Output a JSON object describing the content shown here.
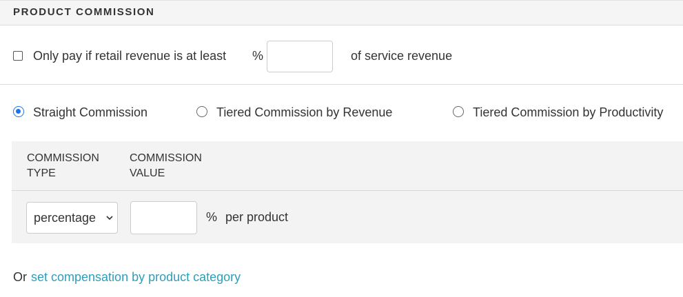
{
  "section": {
    "title": "PRODUCT COMMISSION"
  },
  "min_retail": {
    "label": "Only pay if retail revenue is at least",
    "percent_symbol": "%",
    "value": "",
    "suffix": "of service revenue",
    "checked": false
  },
  "commission_modes": [
    {
      "label": "Straight Commission",
      "selected": true
    },
    {
      "label": "Tiered Commission by Revenue",
      "selected": false
    },
    {
      "label": "Tiered Commission by Productivity",
      "selected": false
    }
  ],
  "table": {
    "headers": [
      {
        "line1": "COMMISSION",
        "line2": "TYPE"
      },
      {
        "line1": "COMMISSION",
        "line2": "VALUE"
      }
    ],
    "row": {
      "type_selected": "percentage",
      "value": "",
      "percent_symbol": "%",
      "unit_text": "per product"
    }
  },
  "footer": {
    "prefix": "Or",
    "link_text": "set compensation by product category"
  },
  "colors": {
    "accent": "#1a73e8",
    "link": "#2e9fb8",
    "panel_bg": "#f3f3f3",
    "header_bg": "#f5f5f5"
  }
}
